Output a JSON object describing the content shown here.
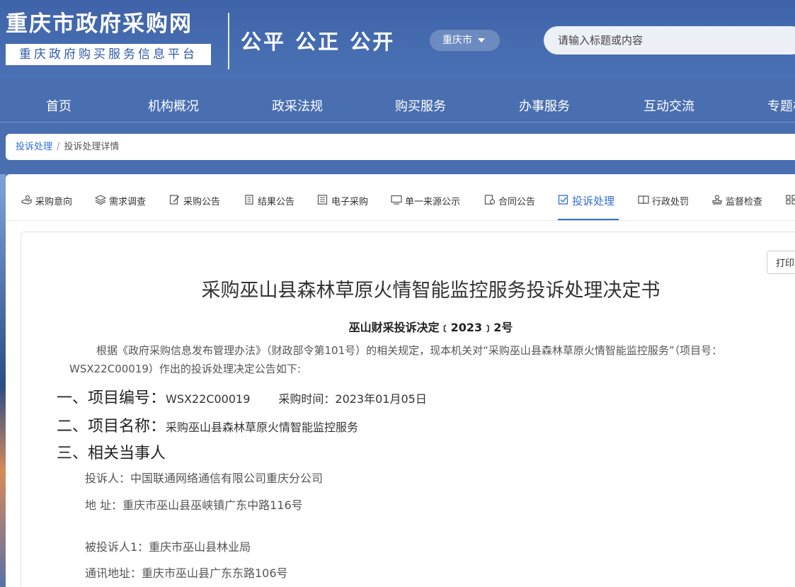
{
  "header": {
    "logo_title": "重庆市政府采购网",
    "logo_subtitle": "重庆政府购买服务信息平台",
    "slogan": "公平 公正 公开",
    "city": "重庆市",
    "search_placeholder": "请输入标题或内容"
  },
  "nav": [
    "首页",
    "机构概况",
    "政采法规",
    "购买服务",
    "办事服务",
    "互动交流",
    "专题栏"
  ],
  "breadcrumb": {
    "parent": "投诉处理",
    "current": "投诉处理详情"
  },
  "tabs": [
    {
      "label": "采购意向",
      "icon": "hand-money-icon"
    },
    {
      "label": "需求调查",
      "icon": "layers-icon"
    },
    {
      "label": "采购公告",
      "icon": "edit-doc-icon"
    },
    {
      "label": "结果公告",
      "icon": "doc-lines-icon"
    },
    {
      "label": "电子采购",
      "icon": "doc-list-icon"
    },
    {
      "label": "单一来源公示",
      "icon": "monitor-icon"
    },
    {
      "label": "合同公告",
      "icon": "contract-icon"
    },
    {
      "label": "投诉处理",
      "icon": "checkbox-icon",
      "active": true
    },
    {
      "label": "行政处罚",
      "icon": "book-icon"
    },
    {
      "label": "监督检查",
      "icon": "stamp-icon"
    }
  ],
  "doc": {
    "print_label": "打印",
    "title": "采购巫山县森林草原火情智能监控服务投诉处理决定书",
    "number": "巫山财采投诉决定﹝2023﹞2号",
    "intro": "根据《政府采购信息发布管理办法》（财政部令第101号）的相关规定，现本机关对“采购巫山县森林草原火情智能监控服务”（项目号：WSX22C00019）作出的投诉处理决定公告如下:",
    "sec1_label": "一、项目编号：",
    "sec1_value": "WSX22C00019",
    "sec1_time": "采购时间：2023年01月05日",
    "sec2_label": "二、项目名称：",
    "sec2_value": "采购巫山县森林草原火情智能监控服务",
    "sec3_label": "三、相关当事人",
    "complainant": "投诉人：中国联通网络通信有限公司重庆分公司",
    "address": "地 址：重庆市巫山县巫峡镇广东中路116号",
    "respondent": "被投诉人1：重庆市巫山县林业局",
    "contact_address": "通讯地址：重庆市巫山县广东东路106号"
  },
  "colors": {
    "header_blue": "#4269ae",
    "accent": "#2f6fd6"
  }
}
